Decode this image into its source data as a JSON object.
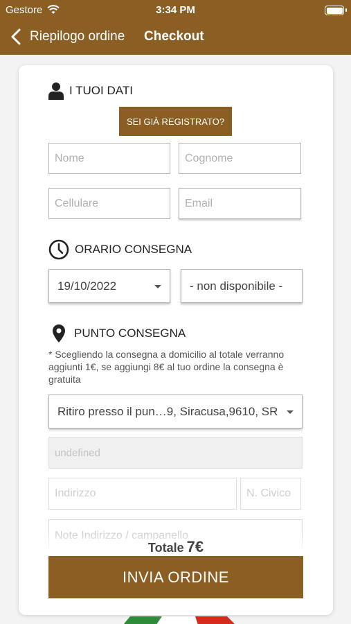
{
  "status_bar": {
    "carrier": "Gestore",
    "time": "3:34 PM"
  },
  "nav": {
    "back_label": "Riepilogo ordine",
    "title": "Checkout"
  },
  "colors": {
    "brand": "#8b5e23"
  },
  "personal": {
    "heading": "I TUOI DATI",
    "icon": "user-icon",
    "registered_button": "SEI GIÀ REGISTRATO?",
    "name_placeholder": "Nome",
    "surname_placeholder": "Cognome",
    "mobile_placeholder": "Cellulare",
    "email_placeholder": "Email"
  },
  "delivery_time": {
    "heading": "ORARIO CONSEGNA",
    "icon": "clock-icon",
    "date_value": "19/10/2022",
    "time_value": "- non disponibile -"
  },
  "delivery_point": {
    "heading": "PUNTO CONSEGNA",
    "icon": "location-pin-icon",
    "note": "* Scegliendo la consegna a domicilio al totale verranno aggiunti 1€, se aggiungi 8€ al tuo ordine la consegna è gratuita",
    "point_value": "Ritiro presso il pun…9, Siracusa,9610, SR",
    "disabled_field_value": "undefined",
    "address_placeholder": "Indirizzo",
    "civic_placeholder": "N. Civico",
    "notes_placeholder": "Note Indirizzo / campanello"
  },
  "total": {
    "label": "Totale",
    "amount": "7€"
  },
  "submit_label": "INVIA ORDINE"
}
